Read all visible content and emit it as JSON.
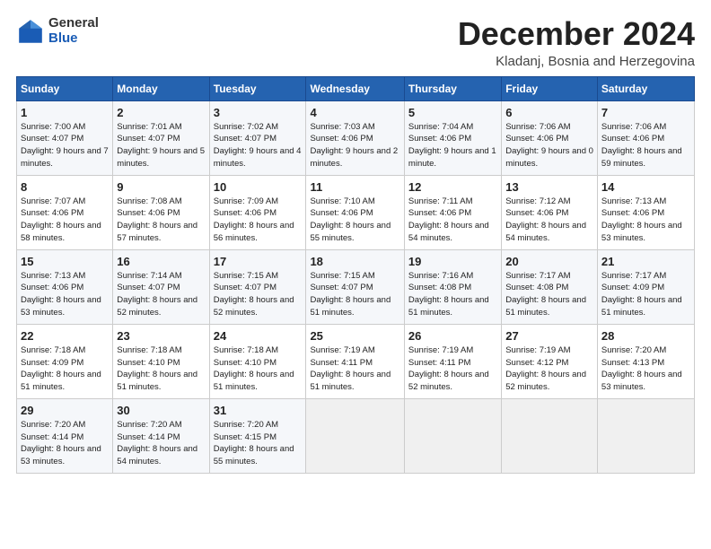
{
  "header": {
    "logo_general": "General",
    "logo_blue": "Blue",
    "month_title": "December 2024",
    "location": "Kladanj, Bosnia and Herzegovina"
  },
  "weekdays": [
    "Sunday",
    "Monday",
    "Tuesday",
    "Wednesday",
    "Thursday",
    "Friday",
    "Saturday"
  ],
  "weeks": [
    [
      {
        "day": "1",
        "sunrise": "7:00 AM",
        "sunset": "4:07 PM",
        "daylight": "9 hours and 7 minutes."
      },
      {
        "day": "2",
        "sunrise": "7:01 AM",
        "sunset": "4:07 PM",
        "daylight": "9 hours and 5 minutes."
      },
      {
        "day": "3",
        "sunrise": "7:02 AM",
        "sunset": "4:07 PM",
        "daylight": "9 hours and 4 minutes."
      },
      {
        "day": "4",
        "sunrise": "7:03 AM",
        "sunset": "4:06 PM",
        "daylight": "9 hours and 2 minutes."
      },
      {
        "day": "5",
        "sunrise": "7:04 AM",
        "sunset": "4:06 PM",
        "daylight": "9 hours and 1 minute."
      },
      {
        "day": "6",
        "sunrise": "7:06 AM",
        "sunset": "4:06 PM",
        "daylight": "9 hours and 0 minutes."
      },
      {
        "day": "7",
        "sunrise": "7:06 AM",
        "sunset": "4:06 PM",
        "daylight": "8 hours and 59 minutes."
      }
    ],
    [
      {
        "day": "8",
        "sunrise": "7:07 AM",
        "sunset": "4:06 PM",
        "daylight": "8 hours and 58 minutes."
      },
      {
        "day": "9",
        "sunrise": "7:08 AM",
        "sunset": "4:06 PM",
        "daylight": "8 hours and 57 minutes."
      },
      {
        "day": "10",
        "sunrise": "7:09 AM",
        "sunset": "4:06 PM",
        "daylight": "8 hours and 56 minutes."
      },
      {
        "day": "11",
        "sunrise": "7:10 AM",
        "sunset": "4:06 PM",
        "daylight": "8 hours and 55 minutes."
      },
      {
        "day": "12",
        "sunrise": "7:11 AM",
        "sunset": "4:06 PM",
        "daylight": "8 hours and 54 minutes."
      },
      {
        "day": "13",
        "sunrise": "7:12 AM",
        "sunset": "4:06 PM",
        "daylight": "8 hours and 54 minutes."
      },
      {
        "day": "14",
        "sunrise": "7:13 AM",
        "sunset": "4:06 PM",
        "daylight": "8 hours and 53 minutes."
      }
    ],
    [
      {
        "day": "15",
        "sunrise": "7:13 AM",
        "sunset": "4:06 PM",
        "daylight": "8 hours and 53 minutes."
      },
      {
        "day": "16",
        "sunrise": "7:14 AM",
        "sunset": "4:07 PM",
        "daylight": "8 hours and 52 minutes."
      },
      {
        "day": "17",
        "sunrise": "7:15 AM",
        "sunset": "4:07 PM",
        "daylight": "8 hours and 52 minutes."
      },
      {
        "day": "18",
        "sunrise": "7:15 AM",
        "sunset": "4:07 PM",
        "daylight": "8 hours and 51 minutes."
      },
      {
        "day": "19",
        "sunrise": "7:16 AM",
        "sunset": "4:08 PM",
        "daylight": "8 hours and 51 minutes."
      },
      {
        "day": "20",
        "sunrise": "7:17 AM",
        "sunset": "4:08 PM",
        "daylight": "8 hours and 51 minutes."
      },
      {
        "day": "21",
        "sunrise": "7:17 AM",
        "sunset": "4:09 PM",
        "daylight": "8 hours and 51 minutes."
      }
    ],
    [
      {
        "day": "22",
        "sunrise": "7:18 AM",
        "sunset": "4:09 PM",
        "daylight": "8 hours and 51 minutes."
      },
      {
        "day": "23",
        "sunrise": "7:18 AM",
        "sunset": "4:10 PM",
        "daylight": "8 hours and 51 minutes."
      },
      {
        "day": "24",
        "sunrise": "7:18 AM",
        "sunset": "4:10 PM",
        "daylight": "8 hours and 51 minutes."
      },
      {
        "day": "25",
        "sunrise": "7:19 AM",
        "sunset": "4:11 PM",
        "daylight": "8 hours and 51 minutes."
      },
      {
        "day": "26",
        "sunrise": "7:19 AM",
        "sunset": "4:11 PM",
        "daylight": "8 hours and 52 minutes."
      },
      {
        "day": "27",
        "sunrise": "7:19 AM",
        "sunset": "4:12 PM",
        "daylight": "8 hours and 52 minutes."
      },
      {
        "day": "28",
        "sunrise": "7:20 AM",
        "sunset": "4:13 PM",
        "daylight": "8 hours and 53 minutes."
      }
    ],
    [
      {
        "day": "29",
        "sunrise": "7:20 AM",
        "sunset": "4:14 PM",
        "daylight": "8 hours and 53 minutes."
      },
      {
        "day": "30",
        "sunrise": "7:20 AM",
        "sunset": "4:14 PM",
        "daylight": "8 hours and 54 minutes."
      },
      {
        "day": "31",
        "sunrise": "7:20 AM",
        "sunset": "4:15 PM",
        "daylight": "8 hours and 55 minutes."
      },
      null,
      null,
      null,
      null
    ]
  ]
}
